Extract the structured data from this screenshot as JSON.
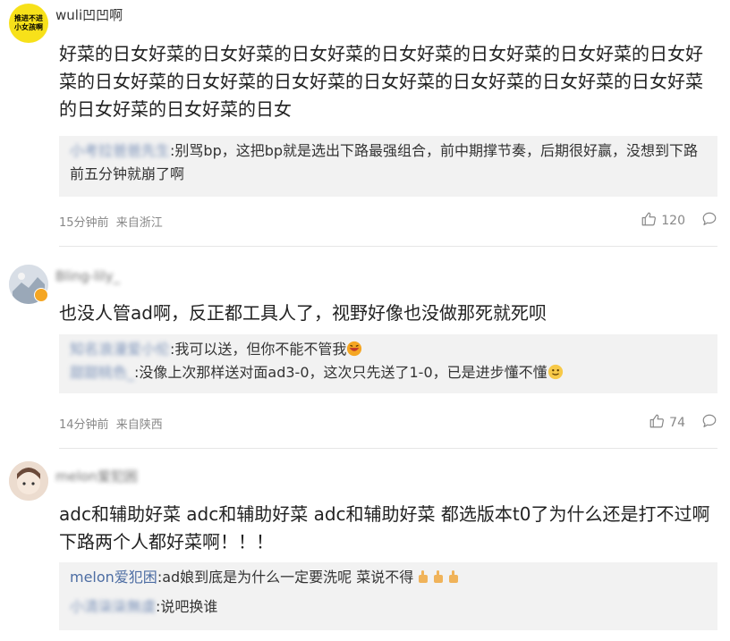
{
  "comments": [
    {
      "username": "wuli凹凹啊",
      "avatar_text": [
        "推进不进",
        "小女孩啊"
      ],
      "text": "好菜的日女好菜的日女好菜的日女好菜的日女好菜的日女好菜的日女好菜的日女好菜的日女好菜的日女好菜的日女好菜的日女好菜的日女好菜的日女好菜的日女好菜的日女好菜的日女好菜的日女",
      "replies": [
        {
          "user": "小考拉爸爸先生",
          "text": ":别骂bp，这把bp就是选出下路最强组合，前中期撑节奏，后期很好赢，没想到下路前五分钟就崩了啊"
        }
      ],
      "time": "15分钟前",
      "location": "来自浙江",
      "likes": "120"
    },
    {
      "username": "Bling-lily_",
      "text": "也没人管ad啊，反正都工具人了，视野好像也没做那死就死呗",
      "replies": [
        {
          "user": "知名浪漫爱小伦",
          "text": ":我可以送，但你不能不管我"
        },
        {
          "user": "甜甜桃色_",
          "text": ":没像上次那样送对面ad3-0，这次只先送了1-0，已是进步懂不懂"
        }
      ],
      "time": "14分钟前",
      "location": "来自陕西",
      "likes": "74"
    },
    {
      "username": "melon爱犯困",
      "text": "adc和辅助好菜 adc和辅助好菜 adc和辅助好菜 都选版本t0了为什么还是打不过啊 下路两个人都好菜啊！！！",
      "replies": [
        {
          "user": "melon爱犯困",
          "text": ":ad娘到底是为什么一定要洗呢 菜说不得"
        },
        {
          "user": "小清柒柒無虞",
          "text": ":说吧换谁"
        }
      ]
    }
  ],
  "colors": {
    "reply_user": "#4d6da3",
    "meta": "#888888",
    "reply_bg": "#f2f2f2",
    "badge": "#f5a623"
  },
  "icons": {
    "like": "thumbs-up-icon",
    "reply": "speech-bubble-icon",
    "verified": "verified-badge-icon"
  }
}
